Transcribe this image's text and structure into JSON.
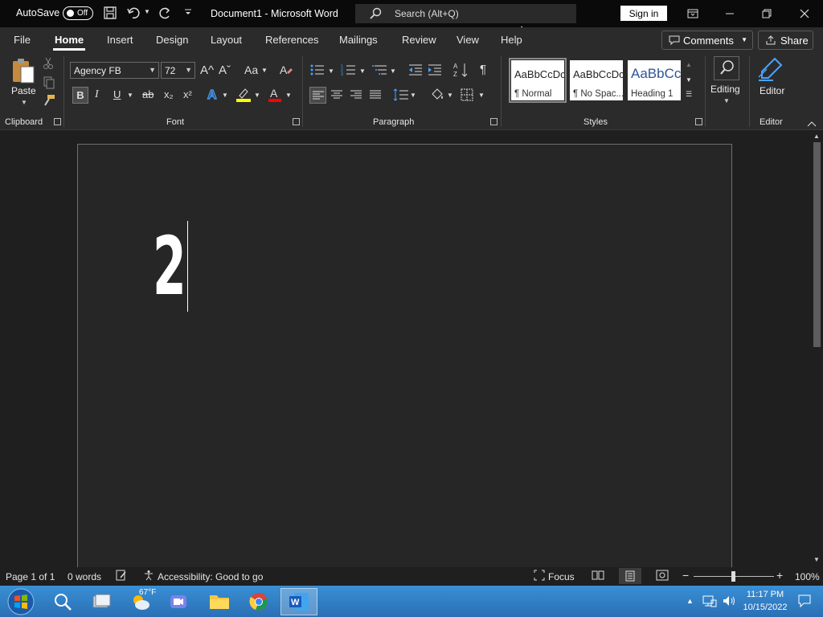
{
  "titlebar": {
    "autosave_label": "AutoSave",
    "autosave_state": "Off",
    "doc_title": "Document1  -  Microsoft Word",
    "search_placeholder": "Search (Alt+Q)",
    "signin_label": "Sign in"
  },
  "tabs": [
    {
      "label": "File"
    },
    {
      "label": "Home"
    },
    {
      "label": "Insert"
    },
    {
      "label": "Design"
    },
    {
      "label": "Layout"
    },
    {
      "label": "References"
    },
    {
      "label": "Mailings"
    },
    {
      "label": "Review"
    },
    {
      "label": "View"
    },
    {
      "label": "Help"
    }
  ],
  "actions": {
    "comments": "Comments",
    "share": "Share"
  },
  "ribbon": {
    "paste_label": "Paste",
    "font_name": "Agency FB",
    "font_size": "72",
    "groups": {
      "clipboard": "Clipboard",
      "font": "Font",
      "paragraph": "Paragraph",
      "styles": "Styles",
      "editor": "Editor"
    },
    "styles": [
      {
        "sample": "AaBbCcDc",
        "name": "¶ Normal"
      },
      {
        "sample": "AaBbCcDc",
        "name": "¶ No Spac..."
      },
      {
        "sample": "AaBbCc",
        "name": "Heading 1"
      }
    ],
    "editing_label": "Editing",
    "editor_label": "Editor",
    "bold": "B",
    "italic": "I",
    "underline": "U",
    "strike": "ab",
    "sub": "x₂",
    "sup": "x²",
    "grow": "A^",
    "shrink": "Aˇ",
    "case": "Aa"
  },
  "document": {
    "text": "2"
  },
  "status": {
    "page": "Page 1 of 1",
    "words": "0 words",
    "accessibility": "Accessibility: Good to go",
    "focus": "Focus",
    "zoom": "100%"
  },
  "taskbar": {
    "weather": "67°F",
    "time": "11:17 PM",
    "date": "10/15/2022"
  },
  "colors": {
    "accent": "#2b579a",
    "highlight": "#ffff00",
    "font_color": "#ff0000"
  }
}
